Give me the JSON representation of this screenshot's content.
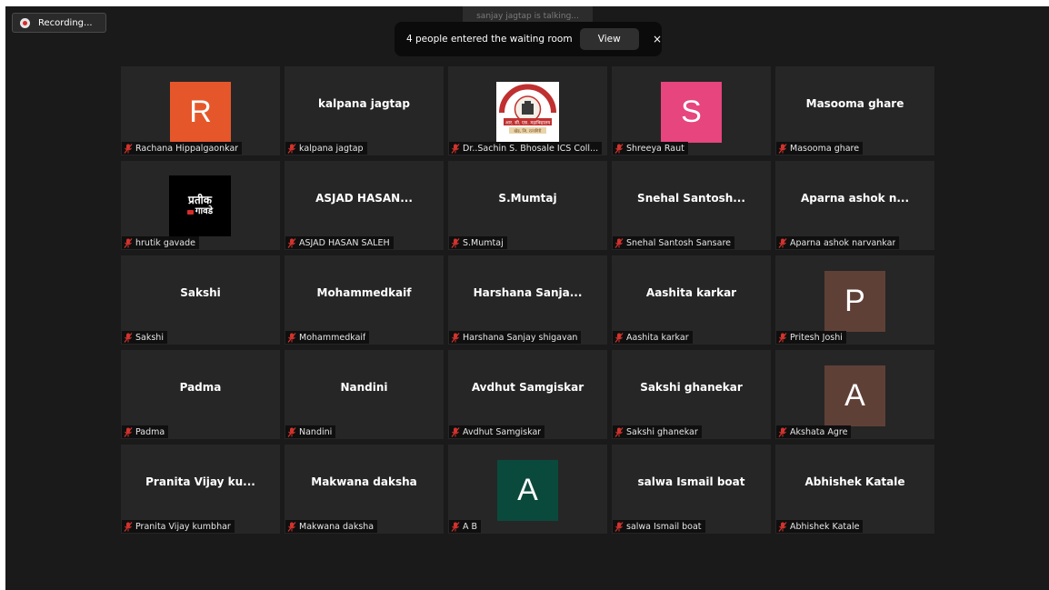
{
  "recording": {
    "label": "Recording..."
  },
  "talking": {
    "text": "sanjay jagtap is talking..."
  },
  "notification": {
    "text": "4 people entered the waiting room",
    "view_label": "View",
    "close_glyph": "×"
  },
  "colors": {
    "muted_mic": "#d2332d",
    "tile_bg": "#262626",
    "avatar_R": "#e5572b",
    "avatar_S": "#e6457d",
    "avatar_P": "#5f4037",
    "avatar_A_brown": "#5f4037",
    "avatar_A_green": "#0a4a3c"
  },
  "participants": [
    {
      "name": "Rachana Hippalgaonkar",
      "display": "",
      "avatar": "R",
      "muted": true
    },
    {
      "name": "kalpana jagtap",
      "display": "kalpana jagtap",
      "muted": true
    },
    {
      "name": "Dr..Sachin S. Bhosale ICS Coll...",
      "display": "",
      "image": "college-logo",
      "logo_text": {
        "line1": "आर. सी. एस. महाविद्यालय",
        "line2": "खेड, जि. रत्नागिरी"
      },
      "muted": true
    },
    {
      "name": "Shreeya Raut",
      "display": "",
      "avatar": "S",
      "muted": true
    },
    {
      "name": "Masooma ghare",
      "display": "Masooma ghare",
      "muted": true
    },
    {
      "name": "hrutik gavade",
      "display": "",
      "image": "hrutik-photo",
      "photo_text": {
        "line1": "प्रतीक",
        "line2": "गावडे"
      },
      "muted": true
    },
    {
      "name": "ASJAD HASAN SALEH",
      "display": "ASJAD HASAN...",
      "muted": true
    },
    {
      "name": "S.Mumtaj",
      "display": "S.Mumtaj",
      "muted": true
    },
    {
      "name": "Snehal Santosh Sansare",
      "display": "Snehal  Santosh...",
      "muted": true
    },
    {
      "name": "Aparna ashok narvankar",
      "display": "Aparna ashok n...",
      "muted": true
    },
    {
      "name": "Sakshi",
      "display": "Sakshi",
      "muted": true
    },
    {
      "name": "Mohammedkaif",
      "display": "Mohammedkaif",
      "muted": true
    },
    {
      "name": "Harshana Sanjay shigavan",
      "display": "Harshana  Sanja...",
      "muted": true
    },
    {
      "name": "Aashita karkar",
      "display": "Aashita karkar",
      "muted": true
    },
    {
      "name": "Pritesh Joshi",
      "display": "",
      "avatar": "P",
      "muted": true
    },
    {
      "name": "Padma",
      "display": "Padma",
      "muted": true
    },
    {
      "name": "Nandini",
      "display": "Nandini",
      "muted": true
    },
    {
      "name": "Avdhut Samgiskar",
      "display": "Avdhut Samgiskar",
      "muted": true
    },
    {
      "name": "Sakshi ghanekar",
      "display": "Sakshi ghanekar",
      "muted": true
    },
    {
      "name": "Akshata Agre",
      "display": "",
      "avatar": "A",
      "muted": true
    },
    {
      "name": "Pranita Vijay kumbhar",
      "display": "Pranita  Vijay  ku...",
      "muted": true
    },
    {
      "name": "Makwana daksha",
      "display": "Makwana daksha",
      "muted": true
    },
    {
      "name": "A B",
      "display": "",
      "avatar": "A",
      "muted": true
    },
    {
      "name": "salwa Ismail boat",
      "display": "salwa Ismail boat",
      "muted": true
    },
    {
      "name": "Abhishek Katale",
      "display": "Abhishek Katale",
      "muted": true
    }
  ]
}
